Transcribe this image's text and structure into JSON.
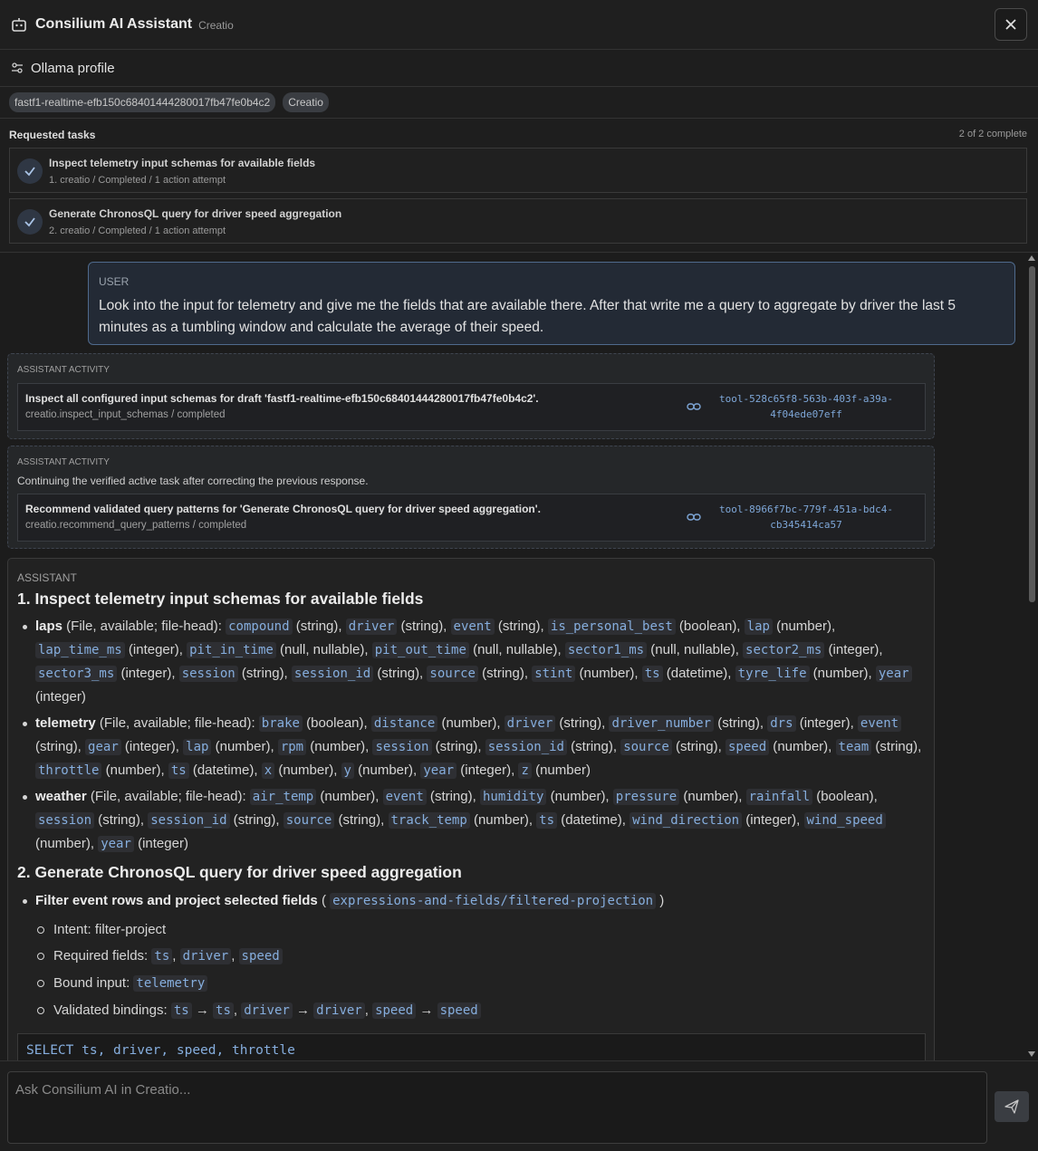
{
  "header": {
    "title": "Consilium AI Assistant",
    "subtitle": "Creatio",
    "icon": "bot-icon",
    "close_icon": "close-icon"
  },
  "profile": {
    "icon": "sliders-icon",
    "label": "Ollama profile"
  },
  "chips": [
    "fastf1-realtime-efb150c68401444280017fb47fe0b4c2",
    "Creatio"
  ],
  "tasks": {
    "title": "Requested tasks",
    "count": "2 of 2 complete",
    "items": [
      {
        "title": "Inspect telemetry input schemas for available fields",
        "meta": "1. creatio / Completed / 1 action attempt"
      },
      {
        "title": "Generate ChronosQL query for driver speed aggregation",
        "meta": "2. creatio / Completed / 1 action attempt"
      }
    ]
  },
  "user_message": {
    "role": "USER",
    "text": "Look into the input for telemetry and give me the fields that are available there. After that write me a query to aggregate by driver the last 5 minutes as a tumbling window and calculate the average of their speed."
  },
  "activities": [
    {
      "role": "ASSISTANT ACTIVITY",
      "note": "",
      "title": "Inspect all configured input schemas for draft 'fastf1-realtime-efb150c68401444280017fb47fe0b4c2'.",
      "meta": "creatio.inspect_input_schemas / completed",
      "tool_id_1": "tool-528c65f8-563b-403f-a39a-",
      "tool_id_2": "4f04ede07eff"
    },
    {
      "role": "ASSISTANT ACTIVITY",
      "note": "Continuing the verified active task after correcting the previous response.",
      "title": "Recommend validated query patterns for 'Generate ChronosQL query for driver speed aggregation'.",
      "meta": "creatio.recommend_query_patterns / completed",
      "tool_id_1": "tool-8966f7bc-779f-451a-bdc4-",
      "tool_id_2": "cb345414ca57"
    }
  ],
  "assistant": {
    "role": "ASSISTANT",
    "heading1": "1. Inspect telemetry input schemas for available fields",
    "heading2": "2. Generate ChronosQL query for driver speed aggregation",
    "schemas": [
      {
        "name": "laps",
        "desc": " (File, available; file-head): ",
        "fields": [
          [
            "compound",
            "string"
          ],
          [
            "driver",
            "string"
          ],
          [
            "event",
            "string"
          ],
          [
            "is_personal_best",
            "boolean"
          ],
          [
            "lap",
            "number"
          ],
          [
            "lap_time_ms",
            "integer"
          ],
          [
            "pit_in_time",
            "null, nullable"
          ],
          [
            "pit_out_time",
            "null, nullable"
          ],
          [
            "sector1_ms",
            "null, nullable"
          ],
          [
            "sector2_ms",
            "integer"
          ],
          [
            "sector3_ms",
            "integer"
          ],
          [
            "session",
            "string"
          ],
          [
            "session_id",
            "string"
          ],
          [
            "source",
            "string"
          ],
          [
            "stint",
            "number"
          ],
          [
            "ts",
            "datetime"
          ],
          [
            "tyre_life",
            "number"
          ],
          [
            "year",
            "integer"
          ]
        ]
      },
      {
        "name": "telemetry",
        "desc": " (File, available; file-head): ",
        "fields": [
          [
            "brake",
            "boolean"
          ],
          [
            "distance",
            "number"
          ],
          [
            "driver",
            "string"
          ],
          [
            "driver_number",
            "string"
          ],
          [
            "drs",
            "integer"
          ],
          [
            "event",
            "string"
          ],
          [
            "gear",
            "integer"
          ],
          [
            "lap",
            "number"
          ],
          [
            "rpm",
            "number"
          ],
          [
            "session",
            "string"
          ],
          [
            "session_id",
            "string"
          ],
          [
            "source",
            "string"
          ],
          [
            "speed",
            "number"
          ],
          [
            "team",
            "string"
          ],
          [
            "throttle",
            "number"
          ],
          [
            "ts",
            "datetime"
          ],
          [
            "x",
            "number"
          ],
          [
            "y",
            "number"
          ],
          [
            "year",
            "integer"
          ],
          [
            "z",
            "number"
          ]
        ]
      },
      {
        "name": "weather",
        "desc": " (File, available; file-head): ",
        "fields": [
          [
            "air_temp",
            "number"
          ],
          [
            "event",
            "string"
          ],
          [
            "humidity",
            "number"
          ],
          [
            "pressure",
            "number"
          ],
          [
            "rainfall",
            "boolean"
          ],
          [
            "session",
            "string"
          ],
          [
            "session_id",
            "string"
          ],
          [
            "source",
            "string"
          ],
          [
            "track_temp",
            "number"
          ],
          [
            "ts",
            "datetime"
          ],
          [
            "wind_direction",
            "integer"
          ],
          [
            "wind_speed",
            "number"
          ],
          [
            "year",
            "integer"
          ]
        ]
      }
    ],
    "pattern": {
      "title": "Filter event rows and project selected fields",
      "path": "expressions-and-fields/filtered-projection",
      "intent_label": "Intent: filter-project",
      "required_label": "Required fields: ",
      "required": [
        "ts",
        "driver",
        "speed"
      ],
      "bound_label": "Bound input: ",
      "bound": "telemetry",
      "bindings_label": "Validated bindings: ",
      "bindings": [
        [
          "ts",
          "ts"
        ],
        [
          "driver",
          "driver"
        ],
        [
          "speed",
          "speed"
        ]
      ]
    },
    "sql_line": "SELECT ts, driver, speed, throttle"
  },
  "composer": {
    "placeholder": "Ask Consilium AI in Creatio...",
    "send_icon": "send-icon"
  },
  "colors": {
    "accent": "#86aede",
    "user_border": "#4f6a8c",
    "background": "#1e1e1e"
  }
}
